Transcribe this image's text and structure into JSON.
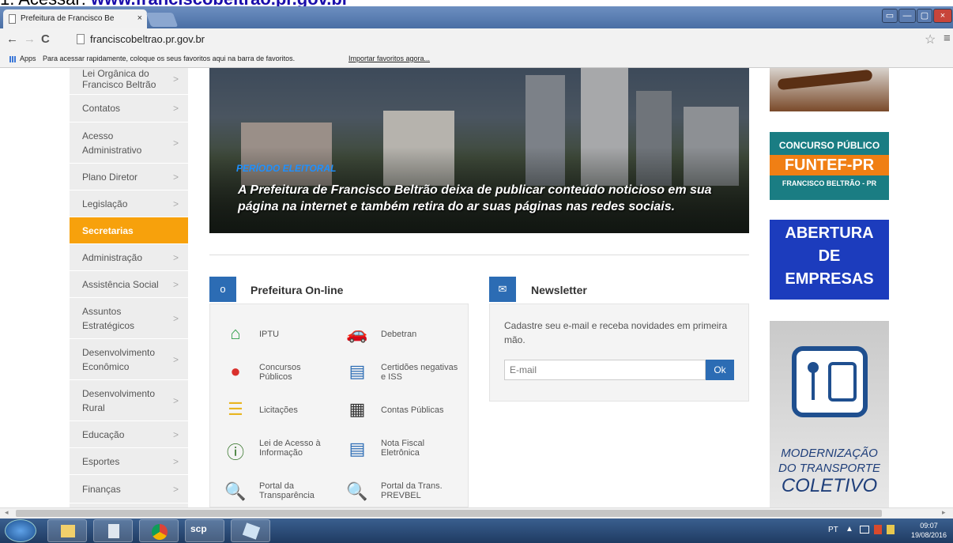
{
  "heading": {
    "prefix": "1. Acessar: ",
    "url": "www.franciscobeltrao.pr.gov.br"
  },
  "browser": {
    "tab_title": "Prefeitura de Francisco Be",
    "tab_close": "×",
    "address": "franciscobeltrao.pr.gov.br",
    "window_buttons": [
      "▭",
      "—",
      "▢",
      "×"
    ],
    "bookmarks": {
      "apps": "Apps",
      "hint": "Para acessar rapidamente, coloque os seus favoritos aqui na barra de favoritos.",
      "import_link": "Importar favoritos agora..."
    }
  },
  "sidebar": {
    "items": [
      {
        "label": "Lei Orgânica do Francisco Beltrão"
      },
      {
        "label": "Contatos"
      },
      {
        "label": "Acesso Administrativo"
      },
      {
        "label": "Plano Diretor"
      },
      {
        "label": "Legislação"
      },
      {
        "label": "Secretarias",
        "active": true
      },
      {
        "label": "Administração"
      },
      {
        "label": "Assistência Social"
      },
      {
        "label": "Assuntos Estratégicos"
      },
      {
        "label": "Desenvolvimento Econômico"
      },
      {
        "label": "Desenvolvimento Rural"
      },
      {
        "label": "Educação"
      },
      {
        "label": "Esportes"
      },
      {
        "label": "Finanças"
      }
    ],
    "chevron": ">"
  },
  "banner": {
    "tag": "PERÍODO ELEITORAL",
    "text": "A Prefeitura de Francisco Beltrão deixa de publicar conteúdo noticioso em sua página na internet e também retira do ar suas páginas nas redes sociais."
  },
  "online": {
    "title": "Prefeitura On-line",
    "icon": "o",
    "items": [
      {
        "label": "IPTU",
        "icon": "home-icon"
      },
      {
        "label": "Debetran",
        "icon": "car-icon"
      },
      {
        "label": "Concursos Públicos",
        "icon": "person-icon"
      },
      {
        "label": "Certidões negativas e ISS",
        "icon": "document-icon"
      },
      {
        "label": "Licitações",
        "icon": "list-icon"
      },
      {
        "label": "Contas Públicas",
        "icon": "calculator-icon"
      },
      {
        "label": "Lei de Acesso à Informação",
        "icon": "info-icon"
      },
      {
        "label": "Nota Fiscal Eletrônica",
        "icon": "invoice-icon"
      },
      {
        "label": "Portal da Transparência",
        "icon": "search-icon"
      },
      {
        "label": "Portal da Trans. PREVBEL",
        "icon": "search-pin-icon"
      }
    ]
  },
  "newsletter": {
    "title": "Newsletter",
    "desc": "Cadastre seu e-mail e receba novidades em primeira mão.",
    "placeholder": "E-mail",
    "ok": "Ok"
  },
  "ads": {
    "concurso": {
      "line1": "CONCURSO PÚBLICO",
      "line2": "FUNTEF-PR",
      "line3": "FRANCISCO BELTRÃO - PR"
    },
    "abertura": {
      "line1": "ABERTURA",
      "line2": "DE",
      "line3": "EMPRESAS"
    },
    "transporte": {
      "line1": "MODERNIZAÇÃO",
      "line2": "DO TRANSPORTE",
      "line3": "COLETIVO"
    }
  },
  "taskbar": {
    "lang": "PT",
    "time": "09:07",
    "date": "19/08/2016",
    "apps": [
      "start",
      "file-explorer",
      "recycle",
      "chrome",
      "scp",
      "app"
    ]
  },
  "colors": {
    "accent_orange": "#f7a10c",
    "primary_blue": "#2c6cb4"
  }
}
